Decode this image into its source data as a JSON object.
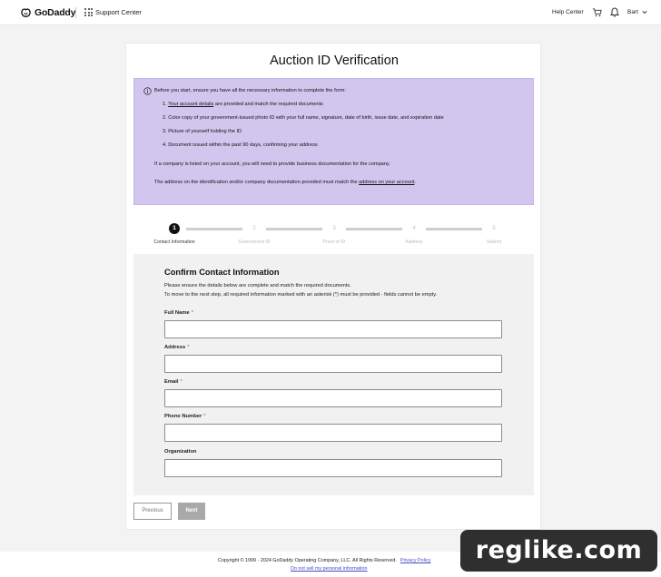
{
  "header": {
    "logo_text": "GoDaddy",
    "support_center": "Support Center",
    "help_center": "Help Center",
    "user_name": "Bart",
    "icons": [
      "godaddy-logo-icon",
      "apps-grid-icon",
      "cart-icon",
      "bell-icon",
      "chevron-down-icon"
    ]
  },
  "page": {
    "title": "Auction ID Verification"
  },
  "notice": {
    "intro": "Before you start, ensure you have all the necessary information to complete the form:",
    "item1_link": "Your account details",
    "item1_rest": " are provided and match the required documents",
    "item2": "Color copy of your government-issued photo ID with your full name, signature, date of birth, issue date, and expiration date",
    "item3": "Picture of yourself holding the ID",
    "item4": "Document issued within the past 90 days, confirming your address",
    "company_note": "If a company is listed on your account, you will need to provide business documentation for the company.",
    "address_note_prefix": "The address on the identification and/or company documentation provided must match the ",
    "address_note_link": "address on your account",
    "address_note_suffix": ".",
    "numbers": [
      "1.",
      "2.",
      "3.",
      "4."
    ]
  },
  "steps": [
    {
      "number": "1",
      "label": "Contact Information"
    },
    {
      "number": "2",
      "label": "Government ID"
    },
    {
      "number": "3",
      "label": "Proof of ID"
    },
    {
      "number": "4",
      "label": "Address"
    },
    {
      "number": "5",
      "label": "Submit"
    }
  ],
  "form": {
    "title": "Confirm Contact Information",
    "desc1": "Please ensure the details below are complete and match the required documents.",
    "desc2": "To move to the next step, all required information marked with an asterisk (*) must be provided - fields cannot be empty.",
    "required_mark": "*",
    "fields": {
      "full_name": {
        "label": "Full Name",
        "value": ""
      },
      "address": {
        "label": "Address",
        "value": ""
      },
      "email": {
        "label": "Email",
        "value": ""
      },
      "phone": {
        "label": "Phone Number",
        "value": ""
      },
      "organization": {
        "label": "Organization",
        "value": ""
      }
    }
  },
  "buttons": {
    "previous": "Previous",
    "next": "Next"
  },
  "footer": {
    "copyright": "Copyright © 1999 - 2024 GoDaddy Operating Company, LLC. All Rights Reserved.",
    "privacy_policy": "Privacy Policy",
    "do_not_sell": "Do not sell my personal information"
  },
  "watermark": {
    "text": "reglike.com"
  },
  "colors": {
    "notice_bg": "#d2c6ee",
    "active_step": "#111111",
    "required": "#dd3333",
    "link": "#4a4ac8"
  }
}
